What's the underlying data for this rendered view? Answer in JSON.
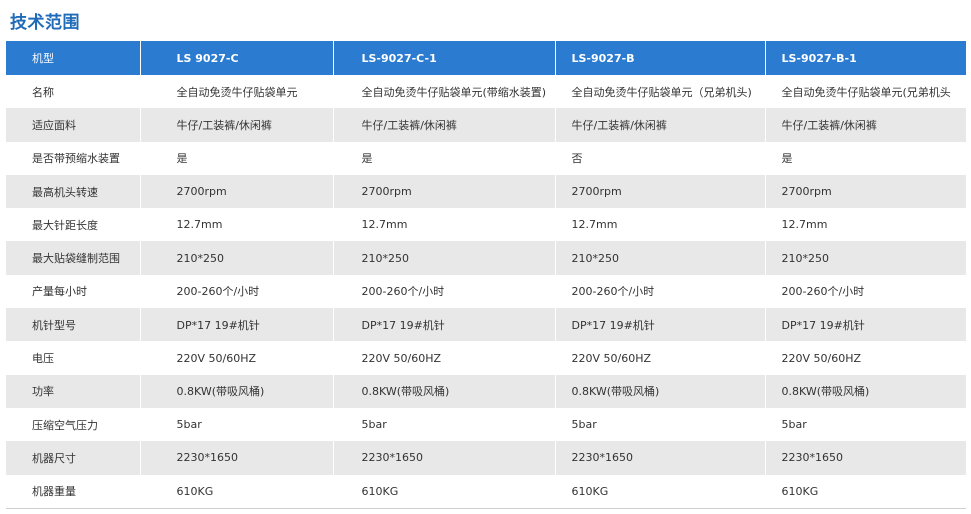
{
  "page_title": "技术范围",
  "table": {
    "header": {
      "label": "机型",
      "models": [
        "LS 9027-C",
        "LS-9027-C-1",
        "LS-9027-B",
        "LS-9027-B-1"
      ]
    },
    "rows": [
      {
        "label": "名称",
        "values": [
          "全自动免烫牛仔贴袋单元",
          "全自动免烫牛仔贴袋单元(带缩水装置)",
          "全自动免烫牛仔贴袋单元（兄弟机头)",
          "全自动免烫牛仔贴袋单元(兄弟机头"
        ]
      },
      {
        "label": "适应面料",
        "values": [
          "牛仔/工装裤/休闲裤",
          "牛仔/工装裤/休闲裤",
          "牛仔/工装裤/休闲裤",
          "牛仔/工装裤/休闲裤"
        ]
      },
      {
        "label": "是否带预缩水装置",
        "values": [
          "是",
          "是",
          "否",
          "是"
        ]
      },
      {
        "label": "最高机头转速",
        "values": [
          "2700rpm",
          "2700rpm",
          "2700rpm",
          "2700rpm"
        ]
      },
      {
        "label": "最大针距长度",
        "values": [
          "12.7mm",
          "12.7mm",
          "12.7mm",
          "12.7mm"
        ]
      },
      {
        "label": "最大贴袋缝制范围",
        "values": [
          "210*250",
          "210*250",
          "210*250",
          "210*250"
        ]
      },
      {
        "label": "产量每小时",
        "values": [
          "200-260个/小时",
          "200-260个/小时",
          "200-260个/小时",
          "200-260个/小时"
        ]
      },
      {
        "label": "机针型号",
        "values": [
          "DP*17 19#机针",
          "DP*17 19#机针",
          "DP*17 19#机针",
          "DP*17 19#机针"
        ]
      },
      {
        "label": "电压",
        "values": [
          "220V 50/60HZ",
          "220V 50/60HZ",
          "220V 50/60HZ",
          "220V 50/60HZ"
        ]
      },
      {
        "label": "功率",
        "values": [
          "0.8KW(带吸风桶)",
          "0.8KW(带吸风桶)",
          "0.8KW(带吸风桶)",
          "0.8KW(带吸风桶)"
        ]
      },
      {
        "label": "压缩空气压力",
        "values": [
          "5bar",
          "5bar",
          "5bar",
          "5bar"
        ]
      },
      {
        "label": "机器尺寸",
        "values": [
          "2230*1650",
          "2230*1650",
          "2230*1650",
          "2230*1650"
        ]
      },
      {
        "label": "机器重量",
        "values": [
          "610KG",
          "610KG",
          "610KG",
          "610KG"
        ]
      }
    ]
  },
  "colors": {
    "title": "#1f6bb8",
    "header_bg": "#2b7bd1",
    "row_alt_bg": "#e8e8e8",
    "text": "#333333"
  }
}
